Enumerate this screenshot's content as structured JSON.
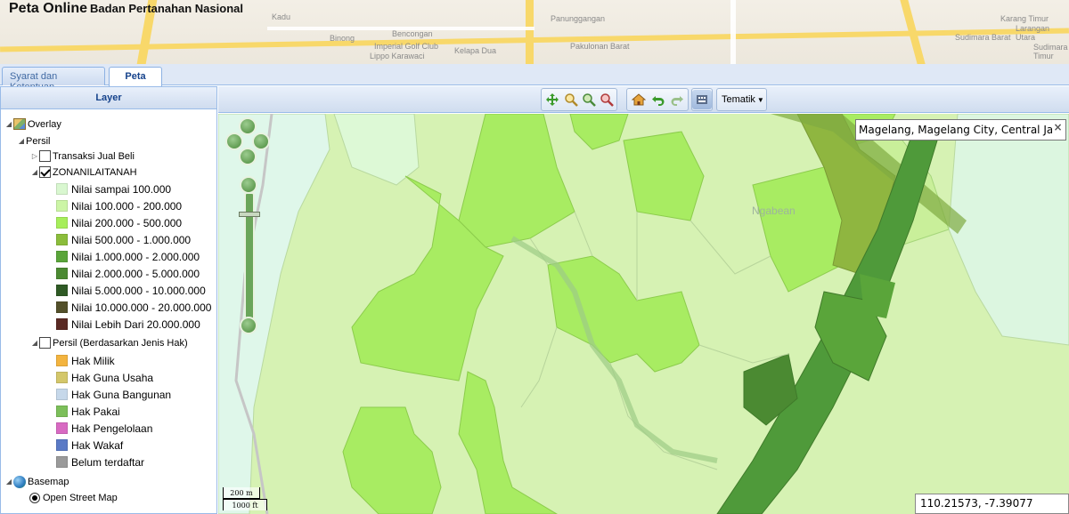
{
  "header": {
    "app_name": "Peta Online",
    "agency": "Badan Pertanahan Nasional",
    "basemap_labels": [
      "Kadu",
      "Binong",
      "Bencongan",
      "Imperial Golf Club",
      "Lippo Karawaci",
      "Kelapa Dua",
      "Panunggangan",
      "Pakulonan Barat",
      "Sudimara Barat",
      "Karang Timur",
      "Larangan Utara",
      "Sudimara Timur"
    ]
  },
  "tabs": [
    {
      "label": "Syarat dan Ketentuan",
      "active": false
    },
    {
      "label": "Peta",
      "active": true
    }
  ],
  "layer_panel": {
    "title": "Layer",
    "overlay_label": "Overlay",
    "persil_label": "Persil",
    "transaksi_label": "Transaksi Jual Beli",
    "zona_label": "ZONANILAITANAH",
    "zona_legend": [
      {
        "label": "Nilai sampai 100.000",
        "color": "#d9f7d0"
      },
      {
        "label": "Nilai 100.000 - 200.000",
        "color": "#ccf5a6"
      },
      {
        "label": "Nilai 200.000 - 500.000",
        "color": "#a6ee5a"
      },
      {
        "label": "Nilai 500.000 - 1.000.000",
        "color": "#8bbd3b"
      },
      {
        "label": "Nilai 1.000.000 - 2.000.000",
        "color": "#5aa53a"
      },
      {
        "label": "Nilai 2.000.000 - 5.000.000",
        "color": "#4b8a32"
      },
      {
        "label": "Nilai 5.000.000 - 10.000.000",
        "color": "#2f5a25"
      },
      {
        "label": "Nilai 10.000.000 - 20.000.000",
        "color": "#53502a"
      },
      {
        "label": "Nilai Lebih Dari 20.000.000",
        "color": "#5a2a24"
      }
    ],
    "persil_hak_label": "Persil (Berdasarkan Jenis Hak)",
    "hak_legend": [
      {
        "label": "Hak Milik",
        "color": "#f3b43f"
      },
      {
        "label": "Hak Guna Usaha",
        "color": "#d4c76a"
      },
      {
        "label": "Hak Guna Bangunan",
        "color": "#c6d8ea"
      },
      {
        "label": "Hak Pakai",
        "color": "#7cbf5a"
      },
      {
        "label": "Hak Pengelolaan",
        "color": "#d86ac2"
      },
      {
        "label": "Hak Wakaf",
        "color": "#5a7ac6"
      },
      {
        "label": "Belum terdaftar",
        "color": "#9a9a9a"
      }
    ],
    "basemap_label": "Basemap",
    "osm_label": "Open Street Map"
  },
  "toolbar": {
    "icons": [
      "pan-icon",
      "zoom-in-box-icon",
      "zoom-out-box-icon",
      "zoom-clear-icon",
      "home-icon",
      "undo-icon",
      "redo-icon",
      "measure-icon"
    ],
    "tematik_label": "Tematik"
  },
  "map": {
    "search_value": "Magelang, Magelang City, Central Java, Indonesia",
    "search_close": "×",
    "place_label": "Ngabean",
    "coords": "110.21573, -7.39077",
    "scale_metric": "200 m",
    "scale_imperial": "1000 ft"
  }
}
